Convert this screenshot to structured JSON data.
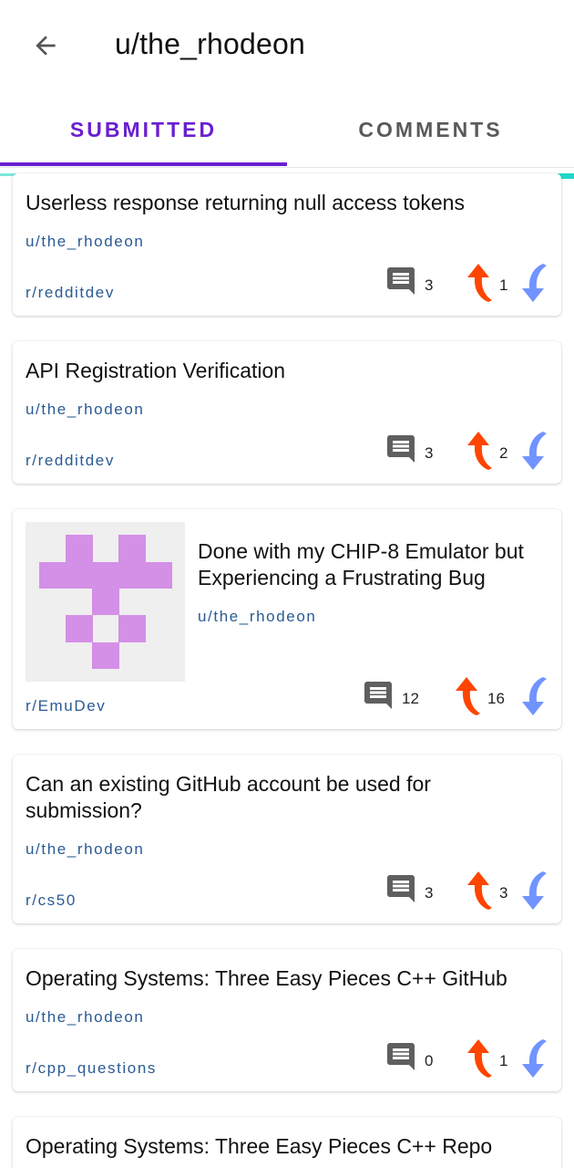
{
  "header": {
    "title": "u/the_rhodeon"
  },
  "tabs": [
    {
      "label": "SUBMITTED"
    },
    {
      "label": "COMMENTS"
    }
  ],
  "posts": [
    {
      "title": "Userless response returning null access tokens",
      "author": "u/the_rhodeon",
      "subreddit": "r/redditdev",
      "comments": "3",
      "score": "1"
    },
    {
      "title": "API Registration Verification",
      "author": "u/the_rhodeon",
      "subreddit": "r/redditdev",
      "comments": "3",
      "score": "2"
    },
    {
      "title": "Done with my CHIP-8 Emulator but Experiencing a Frustrating Bug",
      "author": "u/the_rhodeon",
      "subreddit": "r/EmuDev",
      "comments": "12",
      "score": "16",
      "thumbnail": "pixel-art-icon"
    },
    {
      "title": "Can an existing GitHub account be used for submission?",
      "author": "u/the_rhodeon",
      "subreddit": "r/cs50",
      "comments": "3",
      "score": "3"
    },
    {
      "title": "Operating Systems: Three Easy Pieces C++ GitHub",
      "author": "u/the_rhodeon",
      "subreddit": "r/cpp_questions",
      "comments": "0",
      "score": "1"
    },
    {
      "title": "Operating Systems: Three Easy Pieces C++ Repo"
    }
  ],
  "colors": {
    "accent": "#6a1fcf",
    "link": "#2a5a94",
    "upvote": "#ff4500",
    "downvote": "#7193ff",
    "thumbnail_pixels": "#d48fe6"
  }
}
